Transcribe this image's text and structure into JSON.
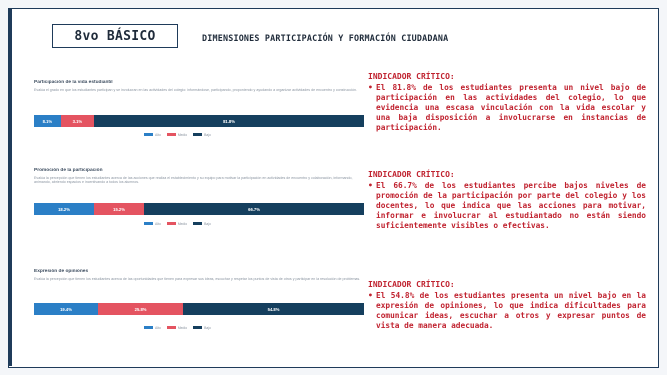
{
  "slide": {
    "badge": "8vo BÁSICO",
    "title": "DIMENSIONES PARTICIPACIÓN Y FORMACIÓN CIUDADANA"
  },
  "colors": {
    "frame": "#1f3b5a",
    "indicator_text": "#c0222f",
    "bar_low": "#2b7fc6",
    "bar_mid": "#e45461",
    "bar_high": "#153f5e"
  },
  "charts": [
    {
      "title": "Participación de la vida estudiantil",
      "description": "Evalúa el grado en que los estudiantes participan y se involucran en las actividades del colegio: informándose, participando, proponiendo y ayudando a organizar actividades de encuentro y construcción.",
      "segments": [
        {
          "label": "8.1%",
          "value": 8.1
        },
        {
          "label": "3.1%",
          "value": 10.1
        },
        {
          "label": "81.8%",
          "value": 81.8
        }
      ],
      "legend": [
        "Alto",
        "Medio",
        "Bajo"
      ]
    },
    {
      "title": "Promoción de la participación",
      "description": "Evalúa la percepción que tienen los estudiantes acerca de las acciones que realiza el establecimiento y su equipo para motivar la participación en actividades de encuentro y colaboración, informando, animando, abriendo espacios e incentivando a todos los alumnos.",
      "segments": [
        {
          "label": "18.2%",
          "value": 18.2
        },
        {
          "label": "15.2%",
          "value": 15.2
        },
        {
          "label": "66.7%",
          "value": 66.7
        }
      ],
      "legend": [
        "Alto",
        "Medio",
        "Bajo"
      ]
    },
    {
      "title": "Expresión de opiniones",
      "description": "Evalúa la percepción que tienen los estudiantes acerca de las oportunidades que tienen para expresar sus ideas, escuchar y respetar los puntos de vista de otros y participar en la resolución de problemas.",
      "segments": [
        {
          "label": "19.4%",
          "value": 19.4
        },
        {
          "label": "25.8%",
          "value": 25.8
        },
        {
          "label": "54.8%",
          "value": 54.8
        }
      ],
      "legend": [
        "Alto",
        "Medio",
        "Bajo"
      ]
    }
  ],
  "indicators": [
    {
      "heading": "INDICADOR CRÍTICO:",
      "bullet": "•",
      "text": "El 81.8% de los estudiantes presenta un nivel bajo de participación en las actividades del colegio, lo que evidencia una escasa vinculación con la vida escolar y una baja disposición a involucrarse en instancias de participación."
    },
    {
      "heading": "INDICADOR CRÍTICO:",
      "bullet": "•",
      "text": "El 66.7% de los estudiantes percibe bajos niveles de promoción de la participación por parte del colegio y los docentes, lo que indica que las acciones para motivar, informar e involucrar al estudiantado no están siendo suficientemente visibles o efectivas."
    },
    {
      "heading": "INDICADOR CRÍTICO:",
      "bullet": "•",
      "text": "El 54.8% de los estudiantes presenta un nivel bajo en la expresión de opiniones, lo que indica dificultades para comunicar ideas, escuchar a otros y expresar puntos de vista de manera adecuada."
    }
  ]
}
